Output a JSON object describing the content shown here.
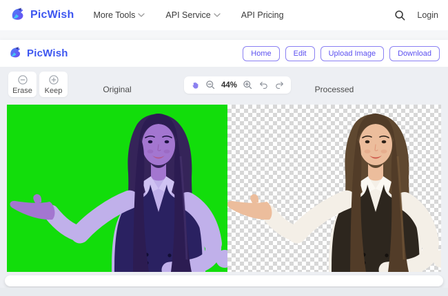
{
  "topnav": {
    "brand": "PicWish",
    "more_tools": "More Tools",
    "api_service": "API Service",
    "api_pricing": "API Pricing",
    "login": "Login"
  },
  "appbar": {
    "brand": "PicWish",
    "buttons": {
      "home": "Home",
      "edit": "Edit",
      "upload": "Upload Image",
      "download": "Download"
    }
  },
  "toolbar": {
    "erase": "Erase",
    "keep": "Keep",
    "zoom_level": "44%"
  },
  "panes": {
    "original_label": "Original",
    "processed_label": "Processed"
  },
  "icons": {
    "search": "magnifier",
    "hand": "grab-hand",
    "zoom_out": "magnifier-minus",
    "zoom_in": "magnifier-plus",
    "undo": "curved-arrow-left",
    "redo": "curved-arrow-right",
    "erase": "circle-minus",
    "keep": "circle-plus",
    "chevron": "chevron-down"
  },
  "colors": {
    "accent_text": "#5b4ff0",
    "accent_border": "#8a80f3",
    "brand_blue": "#3d56f0",
    "green_screen": "#12dd0b",
    "checker_gray": "#d7d7d7",
    "hand_icon_purple": "#8b80f0"
  },
  "scene": {
    "original_alt": "woman on green screen with purple selection tint",
    "processed_alt": "woman cut out on transparent checkerboard"
  }
}
